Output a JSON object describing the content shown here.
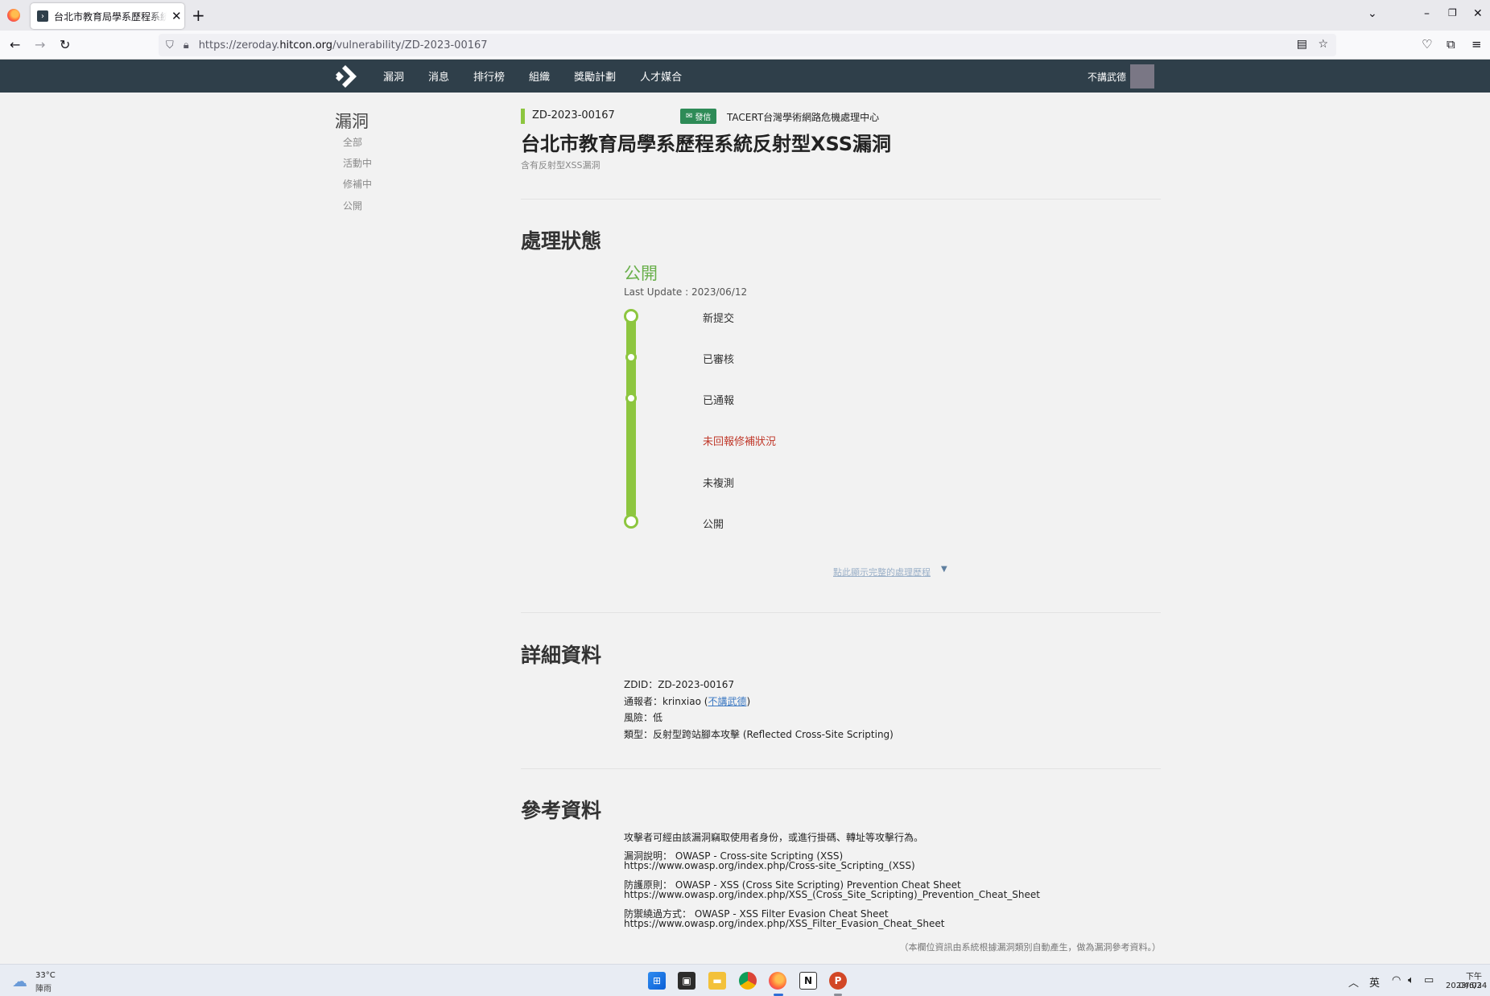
{
  "browser": {
    "tab_title": "台北市教育局學系歷程系統反射",
    "url_prefix": "https://zeroday.",
    "url_domain": "hitcon.org",
    "url_path": "/vulnerability/ZD-2023-00167"
  },
  "site": {
    "nav": [
      "漏洞",
      "消息",
      "排行榜",
      "組織",
      "獎勵計劃",
      "人才媒合"
    ],
    "user": "不講武德"
  },
  "sidebar": {
    "title": "漏洞",
    "items": [
      "全部",
      "活動中",
      "修補中",
      "公開"
    ]
  },
  "vuln": {
    "id": "ZD-2023-00167",
    "badge": "發信",
    "org": "TACERT台灣學術網路危機處理中心",
    "title": "台北市教育局學系歷程系統反射型XSS漏洞",
    "subtitle": "含有反射型XSS漏洞"
  },
  "status": {
    "heading": "處理狀態",
    "current": "公開",
    "last_update": "Last Update : 2023/06/12",
    "steps": [
      "新提交",
      "已審核",
      "已通報",
      "未回報修補狀況",
      "未複測",
      "公開"
    ],
    "history_link": "點此顯示完整的處理歷程"
  },
  "details": {
    "heading": "詳細資料",
    "zdid": "ZDID：ZD-2023-00167",
    "reporter_prefix": "通報者：krinxiao (",
    "reporter_link": "不講武德",
    "reporter_suffix": ")",
    "risk": "風險：低",
    "type": "類型：反射型跨站腳本攻擊 (Reflected Cross-Site Scripting)"
  },
  "references": {
    "heading": "參考資料",
    "intro": "攻擊者可經由該漏洞竊取使用者身份，或進行掛碼、轉址等攻擊行為。",
    "items": [
      {
        "label": "漏洞說明： OWASP - Cross-site Scripting (XSS)",
        "url": "https://www.owasp.org/index.php/Cross-site_Scripting_(XSS)"
      },
      {
        "label": "防護原則： OWASP - XSS (Cross Site Scripting) Prevention Cheat Sheet",
        "url": "https://www.owasp.org/index.php/XSS_(Cross_Site_Scripting)_Prevention_Cheat_Sheet"
      },
      {
        "label": "防禦繞過方式： OWASP - XSS Filter Evasion Cheat Sheet",
        "url": "https://www.owasp.org/index.php/XSS_Filter_Evasion_Cheat_Sheet"
      }
    ],
    "note": "（本欄位資訊由系統根據漏洞類別自動產生，做為漏洞參考資料。）"
  },
  "taskbar": {
    "temp": "33°C",
    "weather": "陣雨",
    "ime": "英",
    "time": "下午 04:03",
    "date": "2023/6/24"
  },
  "colors": {
    "header_bg": "#2f3f4a",
    "accent_green": "#8dc63f",
    "status_green": "#6ab04c",
    "alert_red": "#c0392b",
    "badge_green": "#2e8b57"
  }
}
